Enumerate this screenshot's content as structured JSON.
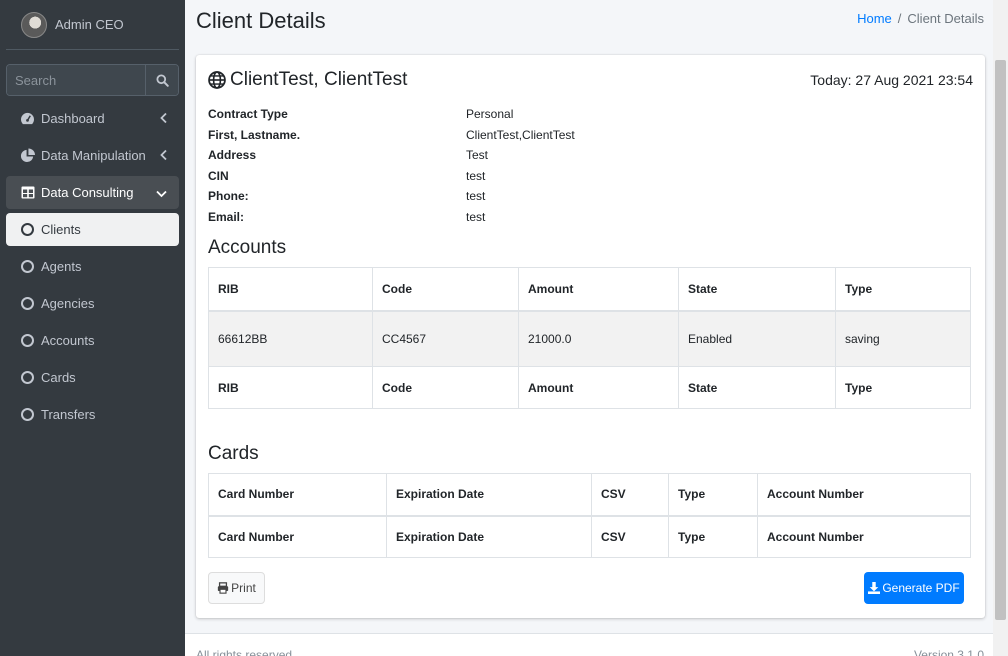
{
  "user": {
    "name": "Admin CEO"
  },
  "search": {
    "placeholder": "Search"
  },
  "sidebar": {
    "items": [
      {
        "label": "Dashboard"
      },
      {
        "label": "Data Manipulation"
      },
      {
        "label": "Data Consulting"
      },
      {
        "label": "Clients"
      },
      {
        "label": "Agents"
      },
      {
        "label": "Agencies"
      },
      {
        "label": "Accounts"
      },
      {
        "label": "Cards"
      },
      {
        "label": "Transfers"
      }
    ]
  },
  "page": {
    "title": "Client Details"
  },
  "breadcrumb": {
    "home": "Home",
    "sep": "/",
    "current": "Client Details"
  },
  "client": {
    "name": "ClientTest, ClientTest",
    "today": "Today: 27 Aug 2021 23:54",
    "fields": [
      {
        "label": "Contract Type",
        "value": "Personal"
      },
      {
        "label": "First, Lastname.",
        "value": "ClientTest,ClientTest"
      },
      {
        "label": "Address",
        "value": "Test"
      },
      {
        "label": "CIN",
        "value": "test"
      },
      {
        "label": "Phone:",
        "value": "test"
      },
      {
        "label": "Email:",
        "value": "test"
      }
    ]
  },
  "accounts": {
    "title": "Accounts",
    "columns": [
      "RIB",
      "Code",
      "Amount",
      "State",
      "Type"
    ],
    "rows": [
      [
        "66612BB",
        "CC4567",
        "21000.0",
        "Enabled",
        "saving"
      ]
    ]
  },
  "cards": {
    "title": "Cards",
    "columns": [
      "Card Number",
      "Expiration Date",
      "CSV",
      "Type",
      "Account Number"
    ]
  },
  "buttons": {
    "print": "Print",
    "pdf": "Generate PDF"
  },
  "footer": {
    "left": "All rights reserved.",
    "right": "Version 3.1.0"
  },
  "colors": {
    "sidebar": "#343a40",
    "primary": "#007bff",
    "background": "#f4f6f9"
  }
}
